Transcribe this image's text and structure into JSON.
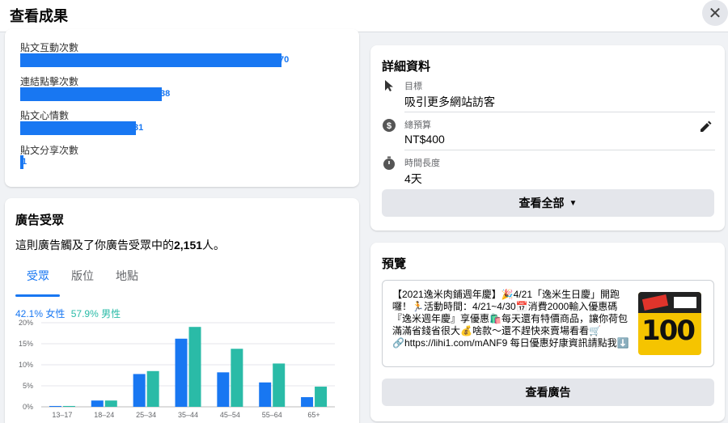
{
  "header": {
    "title": "查看成果"
  },
  "metrics": [
    {
      "label": "貼文互動次數",
      "value": 70
    },
    {
      "label": "連結點擊次數",
      "value": 38
    },
    {
      "label": "貼文心情數",
      "value": 31
    },
    {
      "label": "貼文分享次數",
      "value": 1
    }
  ],
  "audience": {
    "title": "廣告受眾",
    "reach_prefix": "這則廣告觸及了你廣告受眾中的",
    "reach_count": "2,151",
    "reach_suffix": "人。",
    "tabs": [
      "受眾",
      "版位",
      "地點"
    ],
    "legend": {
      "female": "42.1% 女性",
      "male": "57.9% 男性"
    }
  },
  "chart_data": {
    "type": "bar",
    "categories": [
      "13–17",
      "18–24",
      "25–34",
      "35–44",
      "45–54",
      "55–64",
      "65+"
    ],
    "series": [
      {
        "name": "女性",
        "values": [
          0.2,
          1.5,
          7.8,
          16.2,
          8.2,
          5.8,
          2.3
        ],
        "color": "#1877f2"
      },
      {
        "name": "男性",
        "values": [
          0.2,
          1.5,
          8.5,
          19.0,
          13.8,
          10.3,
          4.8
        ],
        "color": "#2abba7"
      }
    ],
    "yticks": [
      "0%",
      "5%",
      "10%",
      "15%",
      "20%"
    ],
    "ylim": [
      0,
      20
    ],
    "grid": true
  },
  "details": {
    "title": "詳細資料",
    "goal_label": "目標",
    "goal_value": "吸引更多網站訪客",
    "budget_label": "總預算",
    "budget_value": "NT$400",
    "duration_label": "時間長度",
    "duration_value": "4天",
    "see_all": "查看全部"
  },
  "preview": {
    "title": "預覽",
    "text": "【2021逸米肉鋪週年慶】🎉4/21「逸米生日慶」開跑囉！🏃活動時間：4/21~4/30📅消費2000輸入優惠碼『逸米週年慶』享優惠🛍️每天還有特價商品，讓你荷包滿滿省錢省很大💰啥款～還不趕快來賣場看看🛒🔗https://lihi1.com/mANF9 每日優惠好康資訊請點我⬇️",
    "thumb_text": "100",
    "button": "查看廣告"
  },
  "colors": {
    "accent": "#1877f2",
    "male": "#2abba7",
    "female": "#1877f2"
  }
}
